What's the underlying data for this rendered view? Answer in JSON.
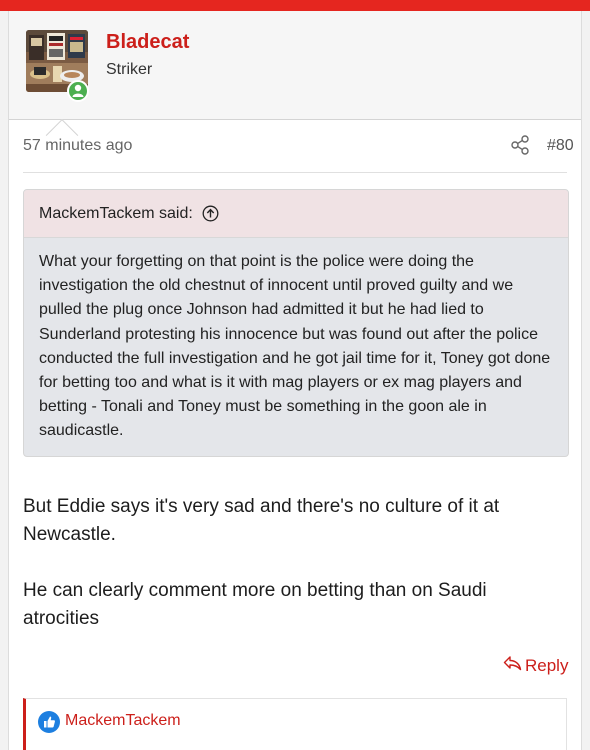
{
  "user": {
    "name": "Bladecat",
    "title": "Striker",
    "online_color": "#4caf50"
  },
  "post": {
    "time": "57 minutes ago",
    "number": "#80",
    "share_icon": "share-icon"
  },
  "quote": {
    "author_said": "MackemTackem said:",
    "text": "What your forgetting on that point is the police were doing the investigation the old chestnut of innocent until proved guilty and we pulled the plug once Johnson had admitted it but he had lied to Sunderland protesting his innocence but was found out after the police conducted the full investigation and he got jail time for it, Toney got done for betting too and what is it with mag players or ex mag players and betting - Tonali and Toney must be something in the goon ale in saudicastle."
  },
  "message": {
    "paragraph1": "But Eddie says it's very sad and there's no culture of it at Newcastle.",
    "paragraph2": "He can clearly comment more on betting than on Saudi atrocities"
  },
  "actions": {
    "reply": "Reply"
  },
  "reactions": {
    "user": "MackemTackem"
  },
  "colors": {
    "accent": "#cc1f1a",
    "topbar": "#e5261f",
    "quote_header_bg": "#f0e2e4",
    "quote_body_bg": "#e4e6ea",
    "like": "#1d7fe0"
  }
}
